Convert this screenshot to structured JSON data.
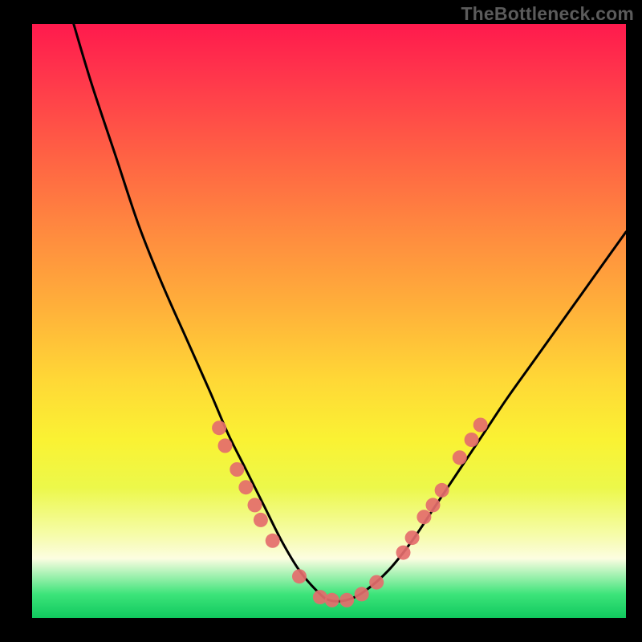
{
  "watermark": "TheBottleneck.com",
  "chart_data": {
    "type": "line",
    "title": "",
    "xlabel": "",
    "ylabel": "",
    "xlim": [
      0,
      100
    ],
    "ylim": [
      0,
      100
    ],
    "grid": false,
    "legend": false,
    "curve": {
      "name": "bottleneck-curve",
      "color": "#000000",
      "x": [
        7,
        10,
        14,
        18,
        22,
        26,
        30,
        33,
        36,
        39,
        42,
        45,
        48,
        50,
        53,
        56,
        60,
        64,
        68,
        72,
        76,
        80,
        85,
        90,
        95,
        100
      ],
      "y": [
        100,
        90,
        78,
        66,
        56,
        47,
        38,
        31,
        25,
        19,
        13,
        8,
        4.5,
        3,
        3,
        4.5,
        8,
        13,
        19,
        25,
        31,
        37,
        44,
        51,
        58,
        65
      ]
    },
    "dots": {
      "name": "data-points",
      "color": "#e46d6d",
      "radius": 9,
      "points": [
        {
          "x": 31.5,
          "y": 32
        },
        {
          "x": 32.5,
          "y": 29
        },
        {
          "x": 34.5,
          "y": 25
        },
        {
          "x": 36.0,
          "y": 22
        },
        {
          "x": 37.5,
          "y": 19
        },
        {
          "x": 38.5,
          "y": 16.5
        },
        {
          "x": 40.5,
          "y": 13
        },
        {
          "x": 45.0,
          "y": 7
        },
        {
          "x": 48.5,
          "y": 3.5
        },
        {
          "x": 50.5,
          "y": 3
        },
        {
          "x": 53.0,
          "y": 3
        },
        {
          "x": 55.5,
          "y": 4
        },
        {
          "x": 58.0,
          "y": 6
        },
        {
          "x": 62.5,
          "y": 11
        },
        {
          "x": 64.0,
          "y": 13.5
        },
        {
          "x": 66.0,
          "y": 17
        },
        {
          "x": 67.5,
          "y": 19
        },
        {
          "x": 69.0,
          "y": 21.5
        },
        {
          "x": 72.0,
          "y": 27
        },
        {
          "x": 74.0,
          "y": 30
        },
        {
          "x": 75.5,
          "y": 32.5
        }
      ]
    },
    "colors": {
      "background_black": "#000000",
      "gradient_top": "#ff1a4d",
      "gradient_mid": "#ffd836",
      "gradient_bottom": "#10c95e",
      "curve": "#000000",
      "dots": "#e46d6d",
      "watermark": "#5b5b5b"
    }
  }
}
